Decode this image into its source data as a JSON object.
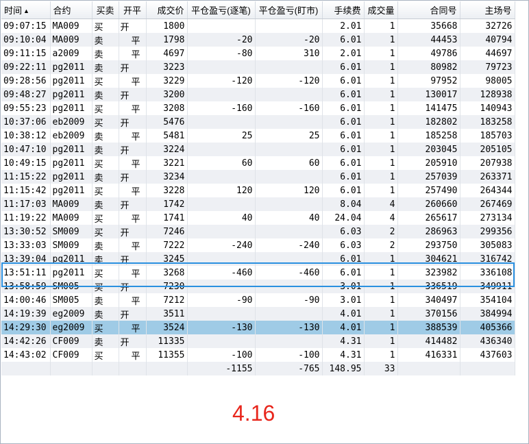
{
  "columns": {
    "time": "时间",
    "contract": "合约",
    "side": "买卖",
    "open_close": "开平",
    "price": "成交价",
    "pnl_trade": "平仓盈亏(逐笔)",
    "pnl_mtm": "平仓盈亏(盯市)",
    "fee": "手续费",
    "qty": "成交量",
    "contract_no": "合同号",
    "exchange_no": "主场号"
  },
  "sort_indicator": "▲",
  "rows": [
    {
      "time": "09:07:15",
      "contract": "MA009",
      "side": "买",
      "side_type": "buy",
      "oc": "开",
      "oc_type": "open",
      "price": "1800",
      "pnl_trade": "",
      "pnl_trade_sign": "",
      "pnl_mtm": "",
      "pnl_mtm_sign": "",
      "fee": "2.01",
      "qty": "1",
      "contract_no": "35668",
      "exchange_no": "32726"
    },
    {
      "time": "09:10:04",
      "contract": "MA009",
      "side": "卖",
      "side_type": "sell",
      "oc": "平",
      "oc_type": "close",
      "price": "1798",
      "pnl_trade": "-20",
      "pnl_trade_sign": "neg",
      "pnl_mtm": "-20",
      "pnl_mtm_sign": "neg",
      "fee": "6.01",
      "qty": "1",
      "contract_no": "44453",
      "exchange_no": "40794"
    },
    {
      "time": "09:11:15",
      "contract": "a2009",
      "side": "卖",
      "side_type": "sell",
      "oc": "平",
      "oc_type": "close",
      "price": "4697",
      "pnl_trade": "-80",
      "pnl_trade_sign": "neg",
      "pnl_mtm": "310",
      "pnl_mtm_sign": "pos",
      "fee": "2.01",
      "qty": "1",
      "contract_no": "49786",
      "exchange_no": "44697"
    },
    {
      "time": "09:22:11",
      "contract": "pg2011",
      "side": "卖",
      "side_type": "sell",
      "oc": "开",
      "oc_type": "open",
      "price": "3223",
      "pnl_trade": "",
      "pnl_trade_sign": "",
      "pnl_mtm": "",
      "pnl_mtm_sign": "",
      "fee": "6.01",
      "qty": "1",
      "contract_no": "80982",
      "exchange_no": "79723"
    },
    {
      "time": "09:28:56",
      "contract": "pg2011",
      "side": "买",
      "side_type": "buy",
      "oc": "平",
      "oc_type": "close",
      "price": "3229",
      "pnl_trade": "-120",
      "pnl_trade_sign": "neg",
      "pnl_mtm": "-120",
      "pnl_mtm_sign": "neg",
      "fee": "6.01",
      "qty": "1",
      "contract_no": "97952",
      "exchange_no": "98005"
    },
    {
      "time": "09:48:27",
      "contract": "pg2011",
      "side": "卖",
      "side_type": "sell",
      "oc": "开",
      "oc_type": "open",
      "price": "3200",
      "pnl_trade": "",
      "pnl_trade_sign": "",
      "pnl_mtm": "",
      "pnl_mtm_sign": "",
      "fee": "6.01",
      "qty": "1",
      "contract_no": "130017",
      "exchange_no": "128938"
    },
    {
      "time": "09:55:23",
      "contract": "pg2011",
      "side": "买",
      "side_type": "buy",
      "oc": "平",
      "oc_type": "close",
      "price": "3208",
      "pnl_trade": "-160",
      "pnl_trade_sign": "neg",
      "pnl_mtm": "-160",
      "pnl_mtm_sign": "neg",
      "fee": "6.01",
      "qty": "1",
      "contract_no": "141475",
      "exchange_no": "140943"
    },
    {
      "time": "10:37:06",
      "contract": "eb2009",
      "side": "买",
      "side_type": "buy",
      "oc": "开",
      "oc_type": "open",
      "price": "5476",
      "pnl_trade": "",
      "pnl_trade_sign": "",
      "pnl_mtm": "",
      "pnl_mtm_sign": "",
      "fee": "6.01",
      "qty": "1",
      "contract_no": "182802",
      "exchange_no": "183258"
    },
    {
      "time": "10:38:12",
      "contract": "eb2009",
      "side": "卖",
      "side_type": "sell",
      "oc": "平",
      "oc_type": "close",
      "price": "5481",
      "pnl_trade": "25",
      "pnl_trade_sign": "pos",
      "pnl_mtm": "25",
      "pnl_mtm_sign": "pos",
      "fee": "6.01",
      "qty": "1",
      "contract_no": "185258",
      "exchange_no": "185703"
    },
    {
      "time": "10:47:10",
      "contract": "pg2011",
      "side": "卖",
      "side_type": "sell",
      "oc": "开",
      "oc_type": "open",
      "price": "3224",
      "pnl_trade": "",
      "pnl_trade_sign": "",
      "pnl_mtm": "",
      "pnl_mtm_sign": "",
      "fee": "6.01",
      "qty": "1",
      "contract_no": "203045",
      "exchange_no": "205105"
    },
    {
      "time": "10:49:15",
      "contract": "pg2011",
      "side": "买",
      "side_type": "buy",
      "oc": "平",
      "oc_type": "close",
      "price": "3221",
      "pnl_trade": "60",
      "pnl_trade_sign": "pos",
      "pnl_mtm": "60",
      "pnl_mtm_sign": "pos",
      "fee": "6.01",
      "qty": "1",
      "contract_no": "205910",
      "exchange_no": "207938"
    },
    {
      "time": "11:15:22",
      "contract": "pg2011",
      "side": "卖",
      "side_type": "sell",
      "oc": "开",
      "oc_type": "open",
      "price": "3234",
      "pnl_trade": "",
      "pnl_trade_sign": "",
      "pnl_mtm": "",
      "pnl_mtm_sign": "",
      "fee": "6.01",
      "qty": "1",
      "contract_no": "257039",
      "exchange_no": "263371"
    },
    {
      "time": "11:15:42",
      "contract": "pg2011",
      "side": "买",
      "side_type": "buy",
      "oc": "平",
      "oc_type": "close",
      "price": "3228",
      "pnl_trade": "120",
      "pnl_trade_sign": "pos",
      "pnl_mtm": "120",
      "pnl_mtm_sign": "pos",
      "fee": "6.01",
      "qty": "1",
      "contract_no": "257490",
      "exchange_no": "264344"
    },
    {
      "time": "11:17:03",
      "contract": "MA009",
      "side": "卖",
      "side_type": "sell",
      "oc": "开",
      "oc_type": "open",
      "price": "1742",
      "pnl_trade": "",
      "pnl_trade_sign": "",
      "pnl_mtm": "",
      "pnl_mtm_sign": "",
      "fee": "8.04",
      "qty": "4",
      "contract_no": "260660",
      "exchange_no": "267469"
    },
    {
      "time": "11:19:22",
      "contract": "MA009",
      "side": "买",
      "side_type": "buy",
      "oc": "平",
      "oc_type": "close",
      "price": "1741",
      "pnl_trade": "40",
      "pnl_trade_sign": "pos",
      "pnl_mtm": "40",
      "pnl_mtm_sign": "pos",
      "fee": "24.04",
      "qty": "4",
      "contract_no": "265617",
      "exchange_no": "273134"
    },
    {
      "time": "13:30:52",
      "contract": "SM009",
      "side": "买",
      "side_type": "buy",
      "oc": "开",
      "oc_type": "open",
      "price": "7246",
      "pnl_trade": "",
      "pnl_trade_sign": "",
      "pnl_mtm": "",
      "pnl_mtm_sign": "",
      "fee": "6.03",
      "qty": "2",
      "contract_no": "286963",
      "exchange_no": "299356"
    },
    {
      "time": "13:33:03",
      "contract": "SM009",
      "side": "卖",
      "side_type": "sell",
      "oc": "平",
      "oc_type": "close",
      "price": "7222",
      "pnl_trade": "-240",
      "pnl_trade_sign": "neg",
      "pnl_mtm": "-240",
      "pnl_mtm_sign": "neg",
      "fee": "6.03",
      "qty": "2",
      "contract_no": "293750",
      "exchange_no": "305083"
    },
    {
      "time": "13:39:04",
      "contract": "pg2011",
      "side": "卖",
      "side_type": "sell",
      "oc": "开",
      "oc_type": "open",
      "price": "3245",
      "pnl_trade": "",
      "pnl_trade_sign": "",
      "pnl_mtm": "",
      "pnl_mtm_sign": "",
      "fee": "6.01",
      "qty": "1",
      "contract_no": "304621",
      "exchange_no": "316742"
    },
    {
      "time": "13:51:11",
      "contract": "pg2011",
      "side": "买",
      "side_type": "buy",
      "oc": "平",
      "oc_type": "close",
      "price": "3268",
      "pnl_trade": "-460",
      "pnl_trade_sign": "neg",
      "pnl_mtm": "-460",
      "pnl_mtm_sign": "neg",
      "fee": "6.01",
      "qty": "1",
      "contract_no": "323982",
      "exchange_no": "336108"
    },
    {
      "time": "13:58:59",
      "contract": "SM005",
      "side": "买",
      "side_type": "buy",
      "oc": "开",
      "oc_type": "open",
      "price": "7230",
      "pnl_trade": "",
      "pnl_trade_sign": "",
      "pnl_mtm": "",
      "pnl_mtm_sign": "",
      "fee": "3.01",
      "qty": "1",
      "contract_no": "336519",
      "exchange_no": "349911"
    },
    {
      "time": "14:00:46",
      "contract": "SM005",
      "side": "卖",
      "side_type": "sell",
      "oc": "平",
      "oc_type": "close",
      "price": "7212",
      "pnl_trade": "-90",
      "pnl_trade_sign": "neg",
      "pnl_mtm": "-90",
      "pnl_mtm_sign": "neg",
      "fee": "3.01",
      "qty": "1",
      "contract_no": "340497",
      "exchange_no": "354104"
    },
    {
      "time": "14:19:39",
      "contract": "eg2009",
      "side": "卖",
      "side_type": "sell",
      "oc": "开",
      "oc_type": "open",
      "price": "3511",
      "pnl_trade": "",
      "pnl_trade_sign": "",
      "pnl_mtm": "",
      "pnl_mtm_sign": "",
      "fee": "4.01",
      "qty": "1",
      "contract_no": "370156",
      "exchange_no": "384994"
    },
    {
      "time": "14:29:30",
      "contract": "eg2009",
      "side": "买",
      "side_type": "buy",
      "oc": "平",
      "oc_type": "close",
      "price": "3524",
      "pnl_trade": "-130",
      "pnl_trade_sign": "neg",
      "pnl_mtm": "-130",
      "pnl_mtm_sign": "neg",
      "fee": "4.01",
      "qty": "1",
      "contract_no": "388539",
      "exchange_no": "405366"
    },
    {
      "time": "14:42:26",
      "contract": "CF009",
      "side": "卖",
      "side_type": "sell",
      "oc": "开",
      "oc_type": "open",
      "price": "11335",
      "pnl_trade": "",
      "pnl_trade_sign": "",
      "pnl_mtm": "",
      "pnl_mtm_sign": "",
      "fee": "4.31",
      "qty": "1",
      "contract_no": "414482",
      "exchange_no": "436340"
    },
    {
      "time": "14:43:02",
      "contract": "CF009",
      "side": "买",
      "side_type": "buy",
      "oc": "平",
      "oc_type": "close",
      "price": "11355",
      "pnl_trade": "-100",
      "pnl_trade_sign": "neg",
      "pnl_mtm": "-100",
      "pnl_mtm_sign": "neg",
      "fee": "4.31",
      "qty": "1",
      "contract_no": "416331",
      "exchange_no": "437603"
    }
  ],
  "selected_row": 22,
  "highlight_rows": [
    17,
    18
  ],
  "totals": {
    "pnl_trade": "-1155",
    "pnl_mtm": "-765",
    "fee": "148.95",
    "qty": "33"
  },
  "annotation": "4.16",
  "colors": {
    "buy": "#e8261c",
    "sell": "#1e9a28",
    "selected_row": "#9fcbe6",
    "highlight_border": "#2a90e0",
    "annotation": "#e8261c"
  }
}
